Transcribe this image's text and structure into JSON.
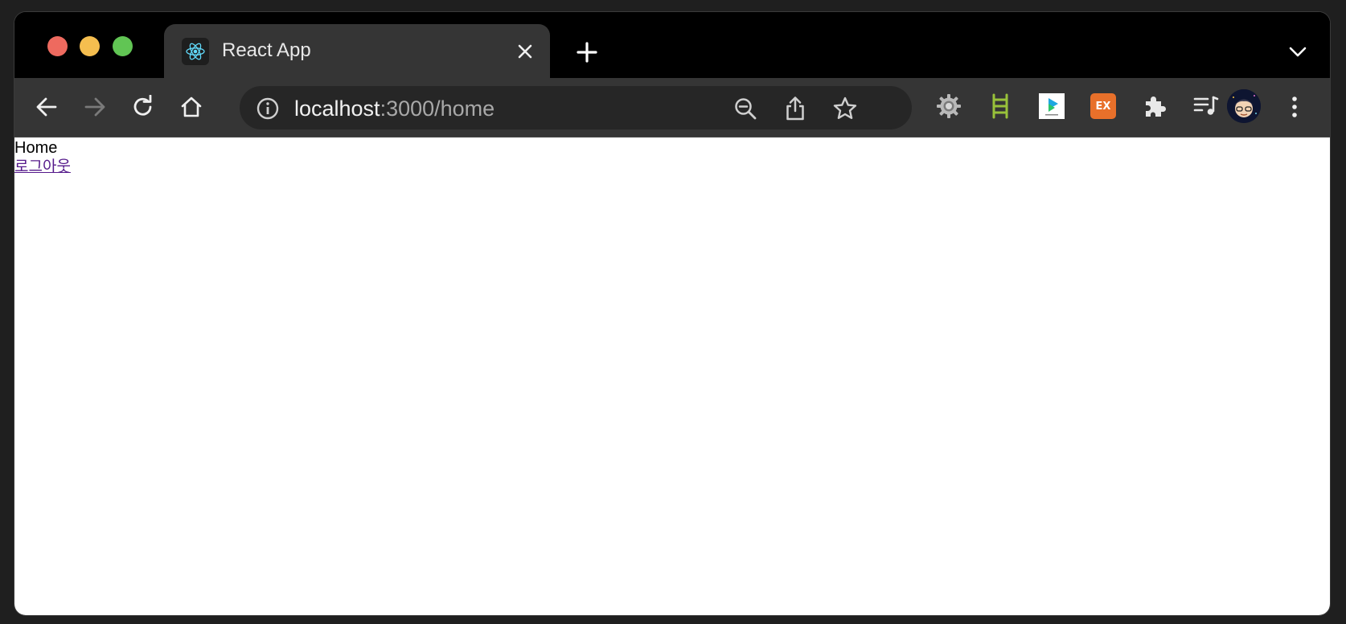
{
  "browser": {
    "tab": {
      "title": "React App",
      "favicon": "react-icon"
    },
    "address_bar": {
      "host": "localhost",
      "path": ":3000/home"
    },
    "icons": {
      "back": "back-arrow-icon",
      "forward": "forward-arrow-icon",
      "reload": "reload-icon",
      "home": "home-icon",
      "zoom": "zoom-out-icon",
      "share": "share-icon",
      "bookmark": "star-icon",
      "extensions": [
        "gear-extension-icon",
        "ladder-extension-icon",
        "papago-extension-icon",
        "ex-extension-icon",
        "puzzle-icon",
        "media-queue-icon"
      ],
      "menu": "kebab-menu-icon"
    },
    "extension_badge": {
      "ex_label": "EX"
    },
    "colors": {
      "frame": "#000000",
      "toolbar": "#353535",
      "omnibox": "#262626",
      "close_red": "#ee6a5f",
      "minimize_yellow": "#f5be4f",
      "maximize_green": "#61c554",
      "react_blue": "#61dafb",
      "visited_link": "#551a8b"
    }
  },
  "page": {
    "heading": "Home",
    "logout_link": "로그아웃"
  }
}
